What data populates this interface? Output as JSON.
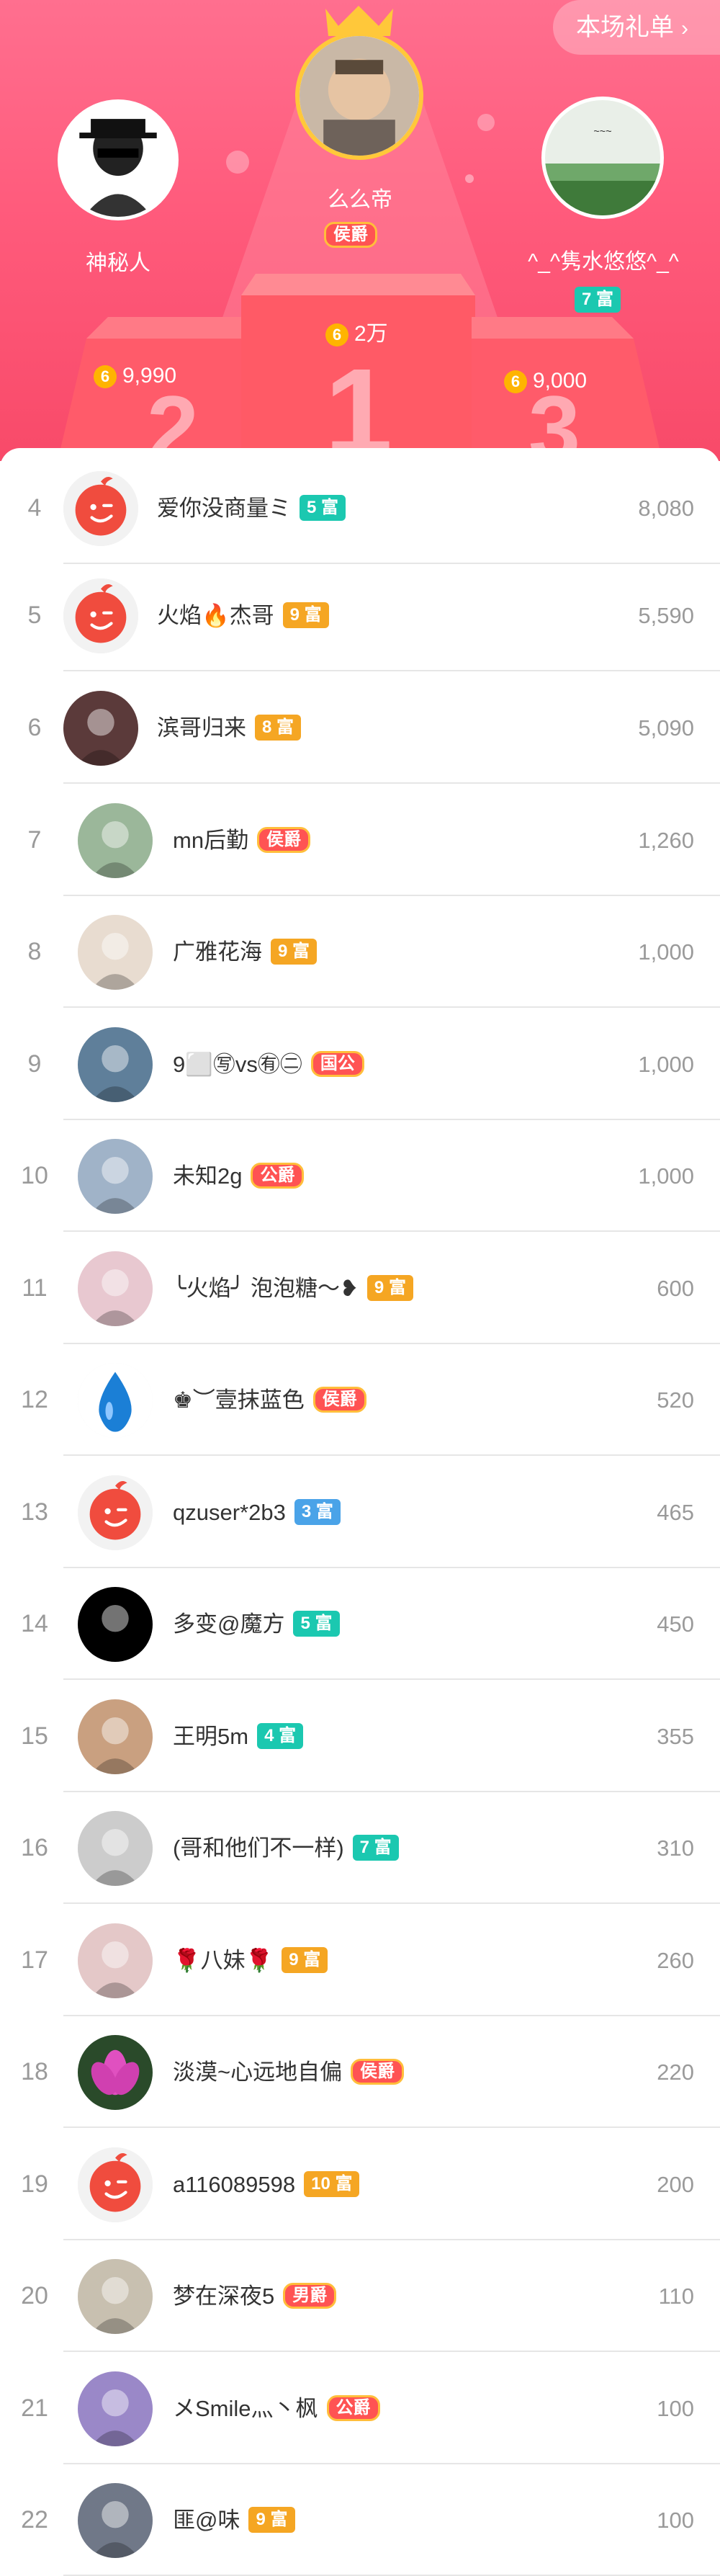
{
  "header": {
    "gift_list_label": "本场礼单"
  },
  "podium": {
    "first": {
      "name": "么么帝",
      "badge": "侯爵",
      "score": "2万",
      "rank_digit": "1"
    },
    "second": {
      "name": "神秘人",
      "score": "9,990",
      "rank_digit": "2"
    },
    "third": {
      "name": "^_^隽水悠悠^_^",
      "badge": "7 富",
      "score": "9,000",
      "rank_digit": "3"
    }
  },
  "rows": [
    {
      "rank": "4",
      "name": "爱你没商量ミ",
      "badge": "5 富",
      "value": "8,080"
    },
    {
      "rank": "5",
      "name": "火焰🔥杰哥",
      "badge": "9 富",
      "value": "5,590"
    },
    {
      "rank": "6",
      "name": "滨哥归来",
      "badge": "8 富",
      "value": "5,090"
    },
    {
      "rank": "7",
      "name": "mn后勤",
      "badge": "侯爵",
      "value": "1,260"
    },
    {
      "rank": "8",
      "name": "广雅花海",
      "badge": "9 富",
      "value": "1,000"
    },
    {
      "rank": "9",
      "name": "9⬜㊢vs㊒㊁",
      "badge": "国公",
      "value": "1,000"
    },
    {
      "rank": "10",
      "name": "未知2g",
      "badge": "公爵",
      "value": "1,000"
    },
    {
      "rank": "11",
      "name": "╰火焰╯ 泡泡糖～❥",
      "badge": "9 富",
      "value": "600"
    },
    {
      "rank": "12",
      "name": "♚︶壹抹蓝色",
      "badge": "侯爵",
      "value": "520"
    },
    {
      "rank": "13",
      "name": "qzuser*2b3",
      "badge": "3 富",
      "value": "465"
    },
    {
      "rank": "14",
      "name": "多变@魔方",
      "badge": "5 富",
      "value": "450"
    },
    {
      "rank": "15",
      "name": "王明5m",
      "badge": "4 富",
      "value": "355"
    },
    {
      "rank": "16",
      "name": "(哥和他们不一样)",
      "badge": "7 富",
      "value": "310"
    },
    {
      "rank": "17",
      "name": "🌹八妹🌹",
      "badge": "9 富",
      "value": "260"
    },
    {
      "rank": "18",
      "name": "淡漠~心远地自偏",
      "badge": "侯爵",
      "value": "220"
    },
    {
      "rank": "19",
      "name": "a116089598",
      "badge": "10 富",
      "value": "200"
    },
    {
      "rank": "20",
      "name": "梦在深夜5",
      "badge": "男爵",
      "value": "110"
    },
    {
      "rank": "21",
      "name": "メSmile灬丶枫",
      "badge": "公爵",
      "value": "100"
    },
    {
      "rank": "22",
      "name": "匪@味",
      "badge": "9 富",
      "value": "100"
    }
  ],
  "colors": {
    "accent": "#ff5b7c",
    "rich_orange": "#f5a623",
    "rich_teal": "#1bc8b0",
    "rich_blue": "#4aa3e8",
    "noble_red": "#ff5353"
  }
}
